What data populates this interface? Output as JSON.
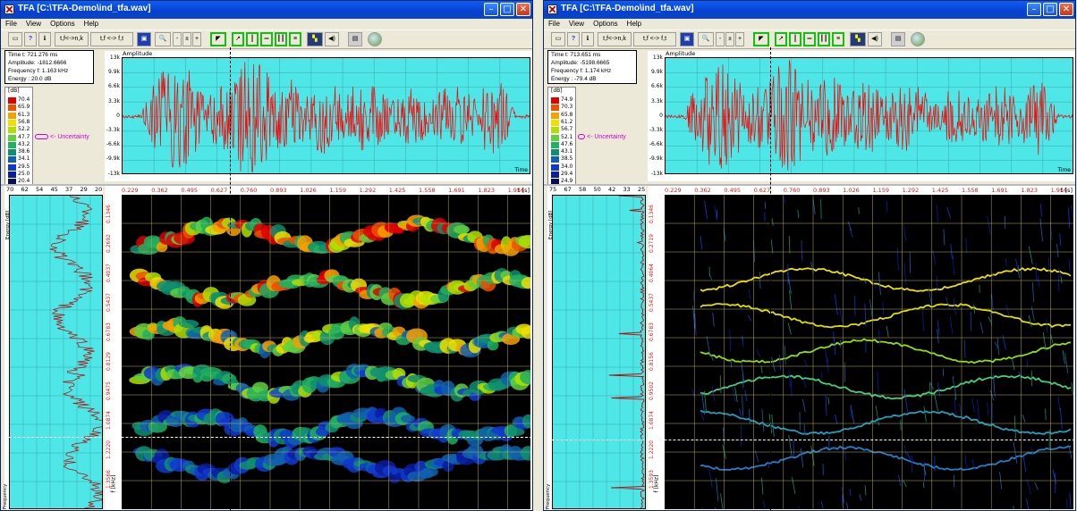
{
  "windows": [
    {
      "id": "left",
      "title": "TFA [C:\\TFA-Demo\\ind_tfa.wav]",
      "menu": [
        "File",
        "View",
        "Options",
        "Help"
      ],
      "toolbar": {
        "tf_conv_1": "t,f<->n,k",
        "tf_conv_2": "t,f <-> f,t"
      },
      "info": {
        "time": "Time t: 721.276 ms",
        "amplitude": "Amplitude: -1812.6666",
        "frequency": "Frequency f: 1.163 kHz",
        "energy": "Energy : 20.0 dB"
      },
      "legend": {
        "unit": "[dB]",
        "levels": [
          "70.4",
          "65.9",
          "61.3",
          "56.8",
          "52.2",
          "47.7",
          "43.2",
          "38.6",
          "34.1",
          "29.5",
          "25.0",
          "20.4"
        ]
      },
      "uncertainty_label": "<- Uncertainty",
      "amplitude_plot": {
        "title": "Amplitude",
        "y_ticks": [
          "13k",
          "9.9k",
          "6.6k",
          "3.3k",
          "0",
          "-3.3k",
          "-6.6k",
          "-9.9k",
          "-13k"
        ],
        "x_label": "Time"
      },
      "energy_plot": {
        "ticks": [
          "70",
          "62",
          "54",
          "45",
          "37",
          "29",
          "20"
        ],
        "side_label": "Energy [dB]",
        "bottom_label": "Frequency"
      },
      "tf_plot": {
        "x_ticks": [
          "0.229",
          "0.362",
          "0.495",
          "0.627",
          "0.760",
          "0.893",
          "1.026",
          "1.159",
          "1.292",
          "1.425",
          "1.558",
          "1.691",
          "1.823",
          "1.956"
        ],
        "t_unit": "t [s]",
        "y_ticks": [
          "0.1346",
          "0.2692",
          "0.4037",
          "0.5437",
          "0.6783",
          "0.8129",
          "0.9475",
          "1.0874",
          "1.2220",
          "1.3566"
        ],
        "f_unit": "f [kHz]"
      }
    },
    {
      "id": "right",
      "title": "TFA [C:\\TFA-Demo\\ind_tfa.wav]",
      "menu": [
        "File",
        "View",
        "Options",
        "Help"
      ],
      "toolbar": {
        "tf_conv_1": "t,f<->n,k",
        "tf_conv_2": "t,f <-> f,t"
      },
      "info": {
        "time": "Time t: 713.651 ms",
        "amplitude": "Amplitude: -5198.6665",
        "frequency": "Frequency f: 1.174 kHz",
        "energy": "Energy : -79.4 dB"
      },
      "legend": {
        "unit": "[dB]",
        "levels": [
          "74.9",
          "70.3",
          "65.8",
          "61.2",
          "56.7",
          "52.1",
          "47.6",
          "43.1",
          "38.5",
          "34.0",
          "29.4",
          "24.9"
        ]
      },
      "uncertainty_label": "<- Uncertainty",
      "amplitude_plot": {
        "title": "Amplitude",
        "y_ticks": [
          "13k",
          "9.9k",
          "6.6k",
          "3.3k",
          "0",
          "-3.3k",
          "-6.6k",
          "-9.9k",
          "-13k"
        ],
        "x_label": "Time"
      },
      "energy_plot": {
        "ticks": [
          "75",
          "67",
          "58",
          "50",
          "42",
          "33",
          "25"
        ],
        "side_label": "Energy [dB]",
        "bottom_label": "Frequency"
      },
      "tf_plot": {
        "x_ticks": [
          "0.229",
          "0.362",
          "0.495",
          "0.627",
          "0.760",
          "0.893",
          "1.026",
          "1.159",
          "1.292",
          "1.425",
          "1.558",
          "1.691",
          "1.823",
          "1.956"
        ],
        "t_unit": "t [s]",
        "y_ticks": [
          "0.1346",
          "0.2719",
          "0.4064",
          "0.5437",
          "0.6783",
          "0.8156",
          "0.9502",
          "1.0874",
          "1.2220",
          "1.3593"
        ],
        "f_unit": "f [kHz]"
      }
    }
  ],
  "legend_colors": [
    "#e00000",
    "#f05000",
    "#f8a000",
    "#f0e000",
    "#b0e000",
    "#60d040",
    "#20b060",
    "#0f8f70",
    "#1060b0",
    "#1038d0",
    "#0a1ca0",
    "#05104c"
  ],
  "waveform_color": "#ff0000",
  "plot_bg": "#4ee6e6"
}
